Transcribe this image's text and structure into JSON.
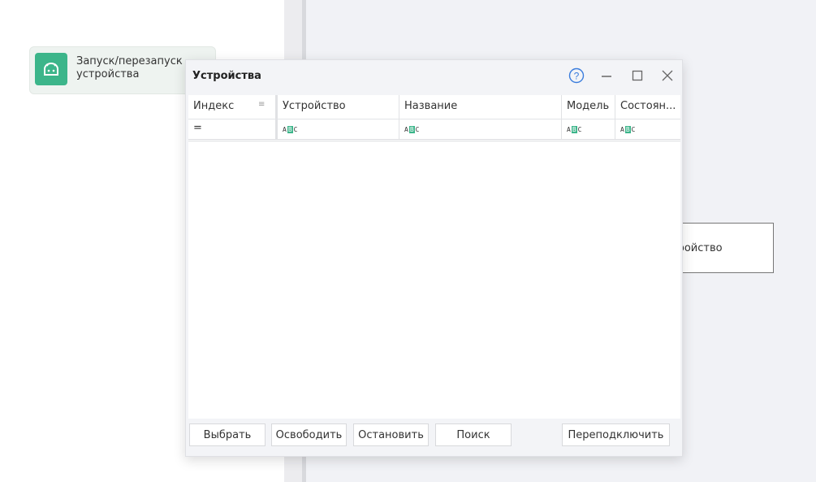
{
  "workflow": {
    "node_launch": {
      "label": "Запуск/перезапуск устройства",
      "icon": "android-icon"
    },
    "node_partial": {
      "label": "тройство"
    }
  },
  "dialog": {
    "title": "Устройства",
    "controls": {
      "help": "?",
      "minimize": "—",
      "maximize": "☐",
      "close": "✕"
    },
    "columns": [
      "Индекс",
      "Устройство",
      "Название",
      "Модель",
      "Состоян..."
    ],
    "filter_row": {
      "index_operator": "=",
      "text_filter_icon": "abc-filter-icon"
    },
    "buttons": {
      "select": "Выбрать",
      "release": "Освободить",
      "stop": "Остановить",
      "search": "Поиск",
      "reconnect": "Переподключить"
    }
  },
  "colors": {
    "accent": "#3cb58a",
    "help": "#3b7ddd"
  }
}
